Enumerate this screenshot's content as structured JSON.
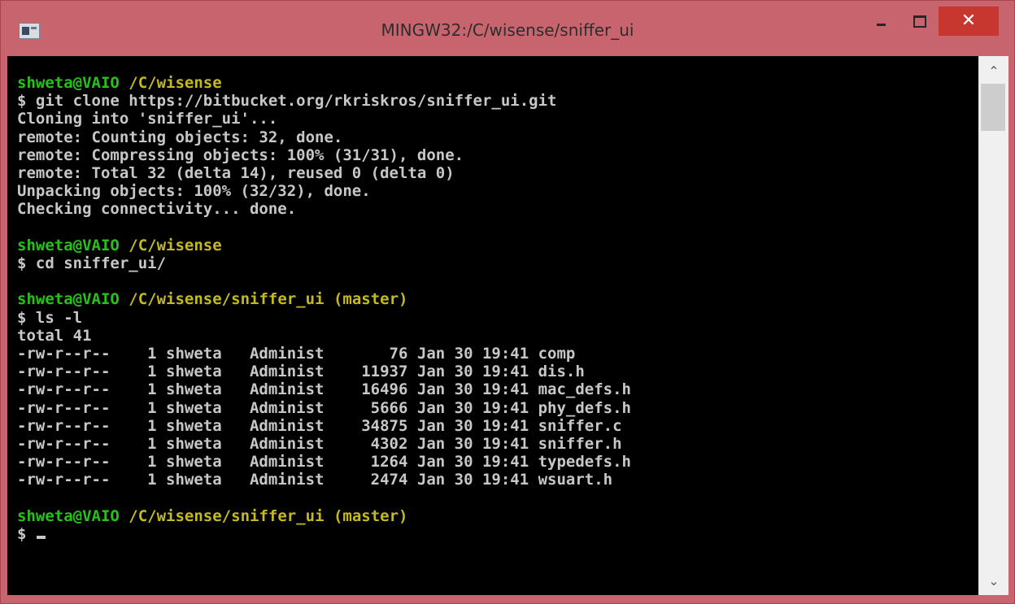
{
  "window": {
    "title": "MINGW32:/C/wisense/sniffer_ui",
    "icon": "console-app-icon",
    "controls": {
      "minimize": "minimize",
      "maximize": "maximize",
      "close": "close",
      "close_glyph": "✕"
    },
    "colors": {
      "frame": "#c8646d",
      "close_button": "#c7362f",
      "console_bg": "#000000",
      "prompt_user": "#27c11a",
      "prompt_path": "#c5b920",
      "text": "#c7c7c7"
    }
  },
  "terminal": {
    "blocks": [
      {
        "prompt": {
          "user": "shweta@VAIO",
          "path": "/C/wisense"
        },
        "command": "$ git clone https://bitbucket.org/rkriskros/sniffer_ui.git",
        "output": [
          "Cloning into 'sniffer_ui'...",
          "remote: Counting objects: 32, done.",
          "remote: Compressing objects: 100% (31/31), done.",
          "remote: Total 32 (delta 14), reused 0 (delta 0)",
          "Unpacking objects: 100% (32/32), done.",
          "Checking connectivity... done."
        ]
      },
      {
        "prompt": {
          "user": "shweta@VAIO",
          "path": "/C/wisense"
        },
        "command": "$ cd sniffer_ui/",
        "output": []
      },
      {
        "prompt": {
          "user": "shweta@VAIO",
          "path": "/C/wisense/sniffer_ui (master)"
        },
        "command": "$ ls -l",
        "output": [
          "total 41",
          "-rw-r--r--    1 shweta   Administ       76 Jan 30 19:41 comp",
          "-rw-r--r--    1 shweta   Administ    11937 Jan 30 19:41 dis.h",
          "-rw-r--r--    1 shweta   Administ    16496 Jan 30 19:41 mac_defs.h",
          "-rw-r--r--    1 shweta   Administ     5666 Jan 30 19:41 phy_defs.h",
          "-rw-r--r--    1 shweta   Administ    34875 Jan 30 19:41 sniffer.c",
          "-rw-r--r--    1 shweta   Administ     4302 Jan 30 19:41 sniffer.h",
          "-rw-r--r--    1 shweta   Administ     1264 Jan 30 19:41 typedefs.h",
          "-rw-r--r--    1 shweta   Administ     2474 Jan 30 19:41 wsuart.h"
        ]
      },
      {
        "prompt": {
          "user": "shweta@VAIO",
          "path": "/C/wisense/sniffer_ui (master)"
        },
        "command": "$ ",
        "output": []
      }
    ]
  },
  "scrollbar": {
    "up_icon": "chevron-up-icon",
    "down_icon": "chevron-down-icon",
    "up_glyph": "⌃",
    "down_glyph": "⌄"
  }
}
